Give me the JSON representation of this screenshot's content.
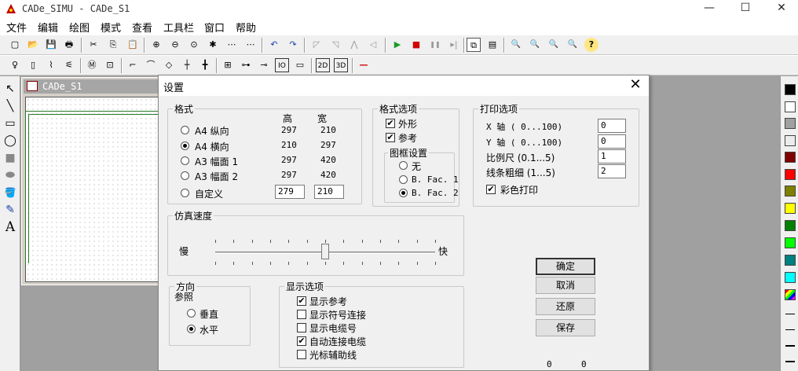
{
  "app": {
    "title": "CADe_SIMU - CADe_S1",
    "window_controls": {
      "minimize": "—",
      "maximize": "☐",
      "close": "✕"
    }
  },
  "menu": [
    "文件",
    "编辑",
    "绘图",
    "模式",
    "查看",
    "工具栏",
    "窗口",
    "帮助"
  ],
  "toolbar1": [
    {
      "icon": "new-file-icon",
      "glyph": "▢"
    },
    {
      "icon": "open-folder-icon",
      "glyph": "📂"
    },
    {
      "icon": "save-icon",
      "glyph": "💾"
    },
    {
      "icon": "print-icon",
      "glyph": "🖶"
    },
    {
      "icon": "cut-icon",
      "glyph": "✂"
    },
    {
      "icon": "copy-icon",
      "glyph": "⎘"
    },
    {
      "icon": "paste-icon",
      "glyph": "📋"
    },
    {
      "icon": "zoom-in-icon",
      "glyph": "⊕"
    },
    {
      "icon": "zoom-out-icon",
      "glyph": "⊖"
    },
    {
      "icon": "zoom-page-icon",
      "glyph": "⊙"
    },
    {
      "icon": "find-icon",
      "glyph": "✱"
    },
    {
      "icon": "grid-icon",
      "glyph": "⋯"
    },
    {
      "icon": "undo-icon",
      "glyph": "↶"
    },
    {
      "icon": "redo-icon",
      "glyph": "↷"
    },
    {
      "icon": "rotate-left-icon",
      "glyph": "◸"
    },
    {
      "icon": "rotate-right-icon",
      "glyph": "◹"
    },
    {
      "icon": "mirror-icon",
      "glyph": "⋀"
    },
    {
      "icon": "flip-icon",
      "glyph": "◁"
    },
    {
      "icon": "play-icon",
      "glyph": "▶"
    },
    {
      "icon": "stop-icon",
      "glyph": "■"
    },
    {
      "icon": "pause-icon",
      "glyph": "❚❚"
    },
    {
      "icon": "step-icon",
      "glyph": "▸|"
    },
    {
      "icon": "window-icon",
      "glyph": "⧉"
    },
    {
      "icon": "layout-icon",
      "glyph": "▤"
    },
    {
      "icon": "zoom-a-icon",
      "glyph": "🔍"
    },
    {
      "icon": "zoom-b-icon",
      "glyph": "🔍"
    },
    {
      "icon": "zoom-c-icon",
      "glyph": "🔍"
    },
    {
      "icon": "zoom-d-icon",
      "glyph": "🔍"
    },
    {
      "icon": "help-icon",
      "glyph": "?"
    }
  ],
  "toolbar2": [
    {
      "icon": "lamp-icon",
      "glyph": "♀"
    },
    {
      "icon": "fuse-icon",
      "glyph": "▯"
    },
    {
      "icon": "switch-icon",
      "glyph": "⌇"
    },
    {
      "icon": "breaker-icon",
      "glyph": "⚟"
    },
    {
      "icon": "motor-icon",
      "glyph": "Ⓜ"
    },
    {
      "icon": "relay-icon",
      "glyph": "⊡"
    },
    {
      "icon": "contact-icon",
      "glyph": "⌐"
    },
    {
      "icon": "contact-no-icon",
      "glyph": "⌒"
    },
    {
      "icon": "diamond-icon",
      "glyph": "◇"
    },
    {
      "icon": "cross-icon",
      "glyph": "┼"
    },
    {
      "icon": "junction-icon",
      "glyph": "╋"
    },
    {
      "icon": "coil-icon",
      "glyph": "⊞"
    },
    {
      "icon": "resistor-icon",
      "glyph": "⊶"
    },
    {
      "icon": "terminal-icon",
      "glyph": "⊸"
    },
    {
      "icon": "io-icon",
      "glyph": "IO"
    },
    {
      "icon": "box-icon",
      "glyph": "▭"
    },
    {
      "icon": "view-2d-icon",
      "glyph": "2D"
    },
    {
      "icon": "view-3d-icon",
      "glyph": "3D"
    },
    {
      "icon": "line-red-icon",
      "glyph": "—"
    }
  ],
  "left_tools": [
    {
      "icon": "pointer-icon",
      "glyph": "↖"
    },
    {
      "icon": "line-icon",
      "glyph": "╲"
    },
    {
      "icon": "rectangle-icon",
      "glyph": "▭"
    },
    {
      "icon": "ellipse-icon",
      "glyph": "◯"
    },
    {
      "icon": "filled-rectangle-icon",
      "glyph": "■"
    },
    {
      "icon": "filled-ellipse-icon",
      "glyph": "⬬"
    },
    {
      "icon": "fill-bucket-icon",
      "glyph": "🪣"
    },
    {
      "icon": "eyedropper-icon",
      "glyph": "✎"
    },
    {
      "icon": "text-tool-icon",
      "glyph": "A"
    }
  ],
  "palette_colors": [
    "#000000",
    "#ffffff",
    "#a0a0a0",
    "#ececec",
    "#800000",
    "#ff0000",
    "#808000",
    "#ffff00",
    "#008000",
    "#00ff00",
    "#008080",
    "#00ffff"
  ],
  "mdi_child": {
    "title": "CADe_S1"
  },
  "dialog": {
    "title": "设置",
    "format": {
      "legend": "格式",
      "col_height": "高",
      "col_width": "宽",
      "options": [
        {
          "label": "A4 纵向",
          "h": "297",
          "w": "210",
          "selected": false
        },
        {
          "label": "A4 横向",
          "h": "210",
          "w": "297",
          "selected": true
        },
        {
          "label": "A3 幅面 1",
          "h": "297",
          "w": "420",
          "selected": false
        },
        {
          "label": "A3 幅面 2",
          "h": "297",
          "w": "420",
          "selected": false
        },
        {
          "label": "自定义",
          "h": "279",
          "w": "210",
          "selected": false
        }
      ]
    },
    "format_options": {
      "legend": "格式选项",
      "outline": {
        "label": "外形",
        "checked": true
      },
      "reference": {
        "label": "参考",
        "checked": true
      },
      "frame": {
        "legend": "图框设置",
        "options": [
          {
            "label": "无",
            "selected": false
          },
          {
            "label": "B. Fac. 1",
            "selected": false
          },
          {
            "label": "B. Fac. 2",
            "selected": true
          }
        ]
      }
    },
    "print_options": {
      "legend": "打印选项",
      "x_axis": {
        "label": "X 轴 ( 0...100)",
        "value": "0"
      },
      "y_axis": {
        "label": "Y 轴 ( 0...100)",
        "value": "0"
      },
      "scale": {
        "label": "比例尺 (0.1...5)",
        "value": "1"
      },
      "line_width": {
        "label": "线条粗细 (1...5)",
        "value": "2"
      },
      "color_print": {
        "label": "彩色打印",
        "checked": true
      }
    },
    "speed": {
      "legend": "仿真速度",
      "slow": "慢",
      "fast": "快",
      "level": 0.5
    },
    "orientation": {
      "legend": "方向",
      "sub": "参照",
      "options": [
        {
          "label": "垂直",
          "selected": false
        },
        {
          "label": "水平",
          "selected": true
        }
      ]
    },
    "display": {
      "legend": "显示选项",
      "options": [
        {
          "label": "显示参考",
          "checked": true
        },
        {
          "label": "显示符号连接",
          "checked": false
        },
        {
          "label": "显示电缆号",
          "checked": false
        },
        {
          "label": "自动连接电缆",
          "checked": true
        },
        {
          "label": "光标辅助线",
          "checked": false
        }
      ]
    },
    "buttons": {
      "ok": "确定",
      "cancel": "取消",
      "restore": "还原",
      "save": "保存"
    },
    "status": {
      "left": "0",
      "right": "0"
    }
  }
}
